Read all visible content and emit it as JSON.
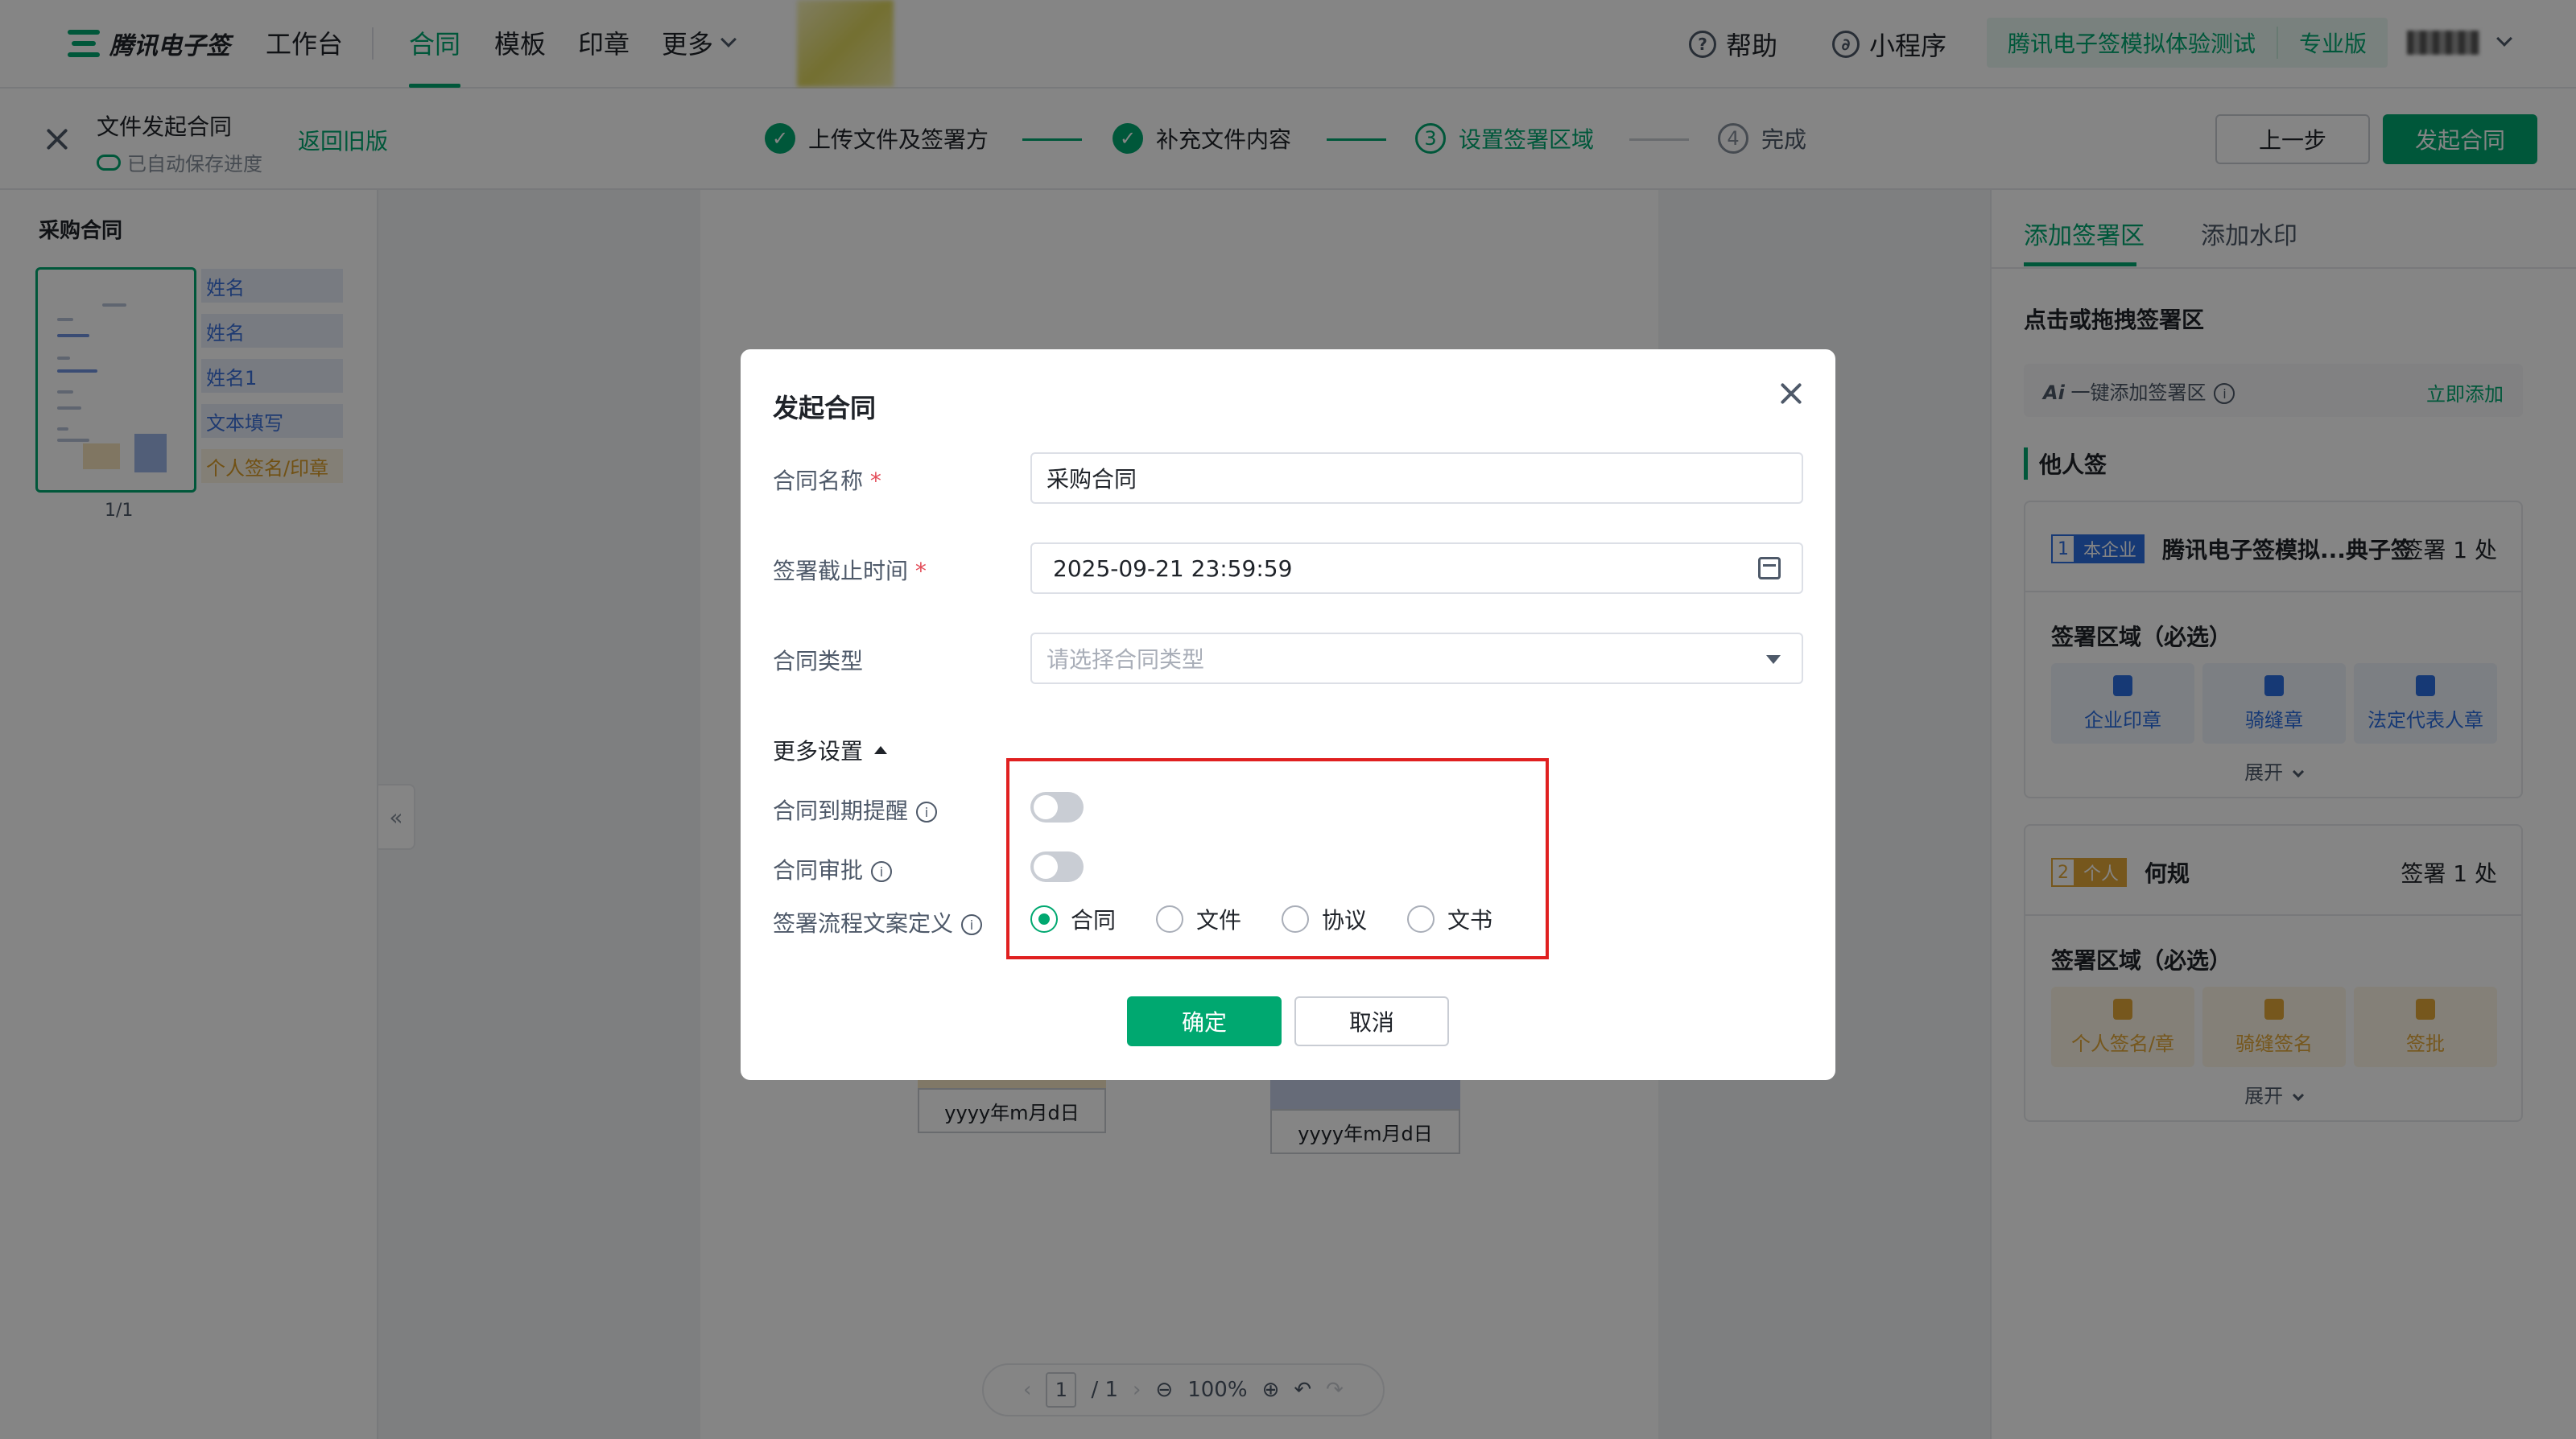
{
  "nav": {
    "logo": "腾讯电子签",
    "items": [
      "工作台",
      "合同",
      "模板",
      "印章",
      "更多"
    ],
    "help": "帮助",
    "miniprogram": "小程序",
    "org_name": "腾讯电子签模拟体验测试",
    "edition": "专业版"
  },
  "subbar": {
    "doc_title": "文件发起合同",
    "autosave": "已自动保存进度",
    "back_old": "返回旧版",
    "steps": [
      {
        "num": "✓",
        "label": "上传文件及签署方"
      },
      {
        "num": "✓",
        "label": "补充文件内容"
      },
      {
        "num": "3",
        "label": "设置签署区域"
      },
      {
        "num": "4",
        "label": "完成"
      }
    ],
    "prev_btn": "上一步",
    "launch_btn": "发起合同"
  },
  "left": {
    "doc_name": "采购合同",
    "page_indicator": "1/1",
    "fields": [
      "姓名",
      "姓名",
      "姓名1",
      "文本填写",
      "个人签名/印章"
    ]
  },
  "canvas": {
    "date_placeholder_1": "yyyy年m月d日",
    "date_placeholder_2": "yyyy年m月d日",
    "toolbar": {
      "page": "1",
      "total": "/ 1",
      "zoom": "100%"
    }
  },
  "right": {
    "tabs": [
      "添加签署区",
      "添加水印"
    ],
    "heading": "点击或拖拽签署区",
    "ai_label": "一键添加签署区",
    "ai_action": "立即添加",
    "others_label": "他人签",
    "cards": [
      {
        "num": "1",
        "type": "本企业",
        "name": "腾讯电子签模拟...典子签",
        "count": "签署 1 处",
        "sub": "签署区域（必选）",
        "chips": [
          "企业印章",
          "骑缝章",
          "法定代表人章"
        ],
        "expand": "展开"
      },
      {
        "num": "2",
        "type": "个人",
        "name": "何规",
        "count": "签署 1 处",
        "sub": "签署区域（必选）",
        "chips": [
          "个人签名/章",
          "骑缝签名",
          "签批"
        ],
        "expand": "展开"
      }
    ]
  },
  "modal": {
    "title": "发起合同",
    "name_label": "合同名称",
    "name_value": "采购合同",
    "deadline_label": "签署截止时间",
    "deadline_value": "2025-09-21 23:59:59",
    "type_label": "合同类型",
    "type_placeholder": "请选择合同类型",
    "more_settings": "更多设置",
    "expiry_label": "合同到期提醒",
    "approval_label": "合同审批",
    "wording_label": "签署流程文案定义",
    "wording_options": [
      "合同",
      "文件",
      "协议",
      "文书"
    ],
    "wording_selected": "合同",
    "ok": "确定",
    "cancel": "取消",
    "expiry_on": false,
    "approval_on": false
  },
  "colors": {
    "accent": "#00a870",
    "highlight": "#e02020",
    "enterprise": "#2b6de0",
    "personal": "#e3a838"
  }
}
